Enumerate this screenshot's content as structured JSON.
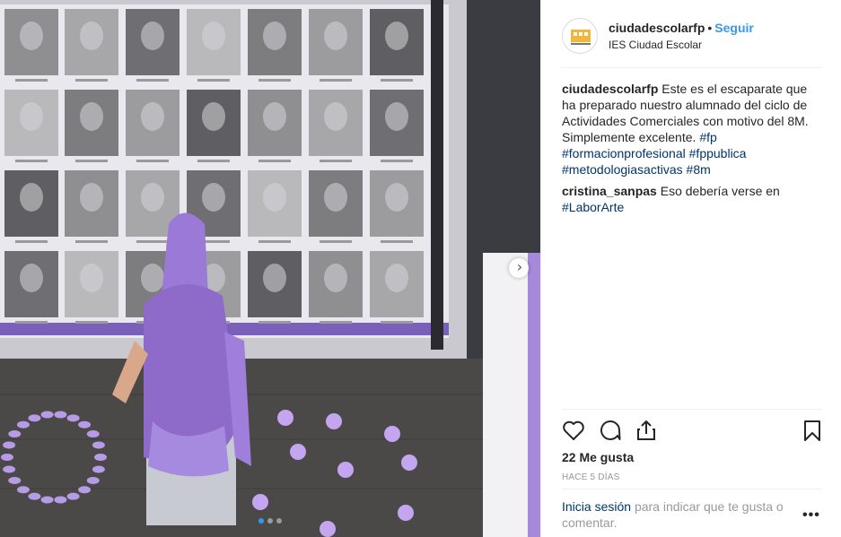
{
  "post": {
    "username": "ciudadescolarfp",
    "separator": "•",
    "follow_label": "Seguir",
    "location": "IES Ciudad Escolar",
    "avatar_text": "CIUDAD ESCOLAR"
  },
  "caption": {
    "username": "ciudadescolarfp",
    "text": "Este es el escaparate que ha preparado nuestro alumnado del ciclo de Actividades Comerciales con motivo del 8M. Simplemente excelente.",
    "hashtags": [
      "#fp",
      "#formacionprofesional",
      "#fppublica",
      "#metodologiasactivas",
      "#8m"
    ]
  },
  "comment": {
    "username": "cristina_sanpas",
    "text": "Eso debería verse en",
    "mention": "#LaborArte"
  },
  "actions": {
    "like_icon": "heart-icon",
    "comment_icon": "comment-icon",
    "share_icon": "share-icon",
    "save_icon": "bookmark-icon"
  },
  "likes": "22 Me gusta",
  "timestamp": "HACE 5 DÍAS",
  "login": {
    "link": "Inicia sesión",
    "text": "para indicar que te gusta o comentar."
  },
  "more_label": "•••",
  "carousel": {
    "slides": 3,
    "current": 1,
    "next_icon": "chevron-right-icon"
  },
  "colors": {
    "accent": "#3897f0",
    "hashtag": "#003569",
    "purple": "#8e6bc9"
  }
}
